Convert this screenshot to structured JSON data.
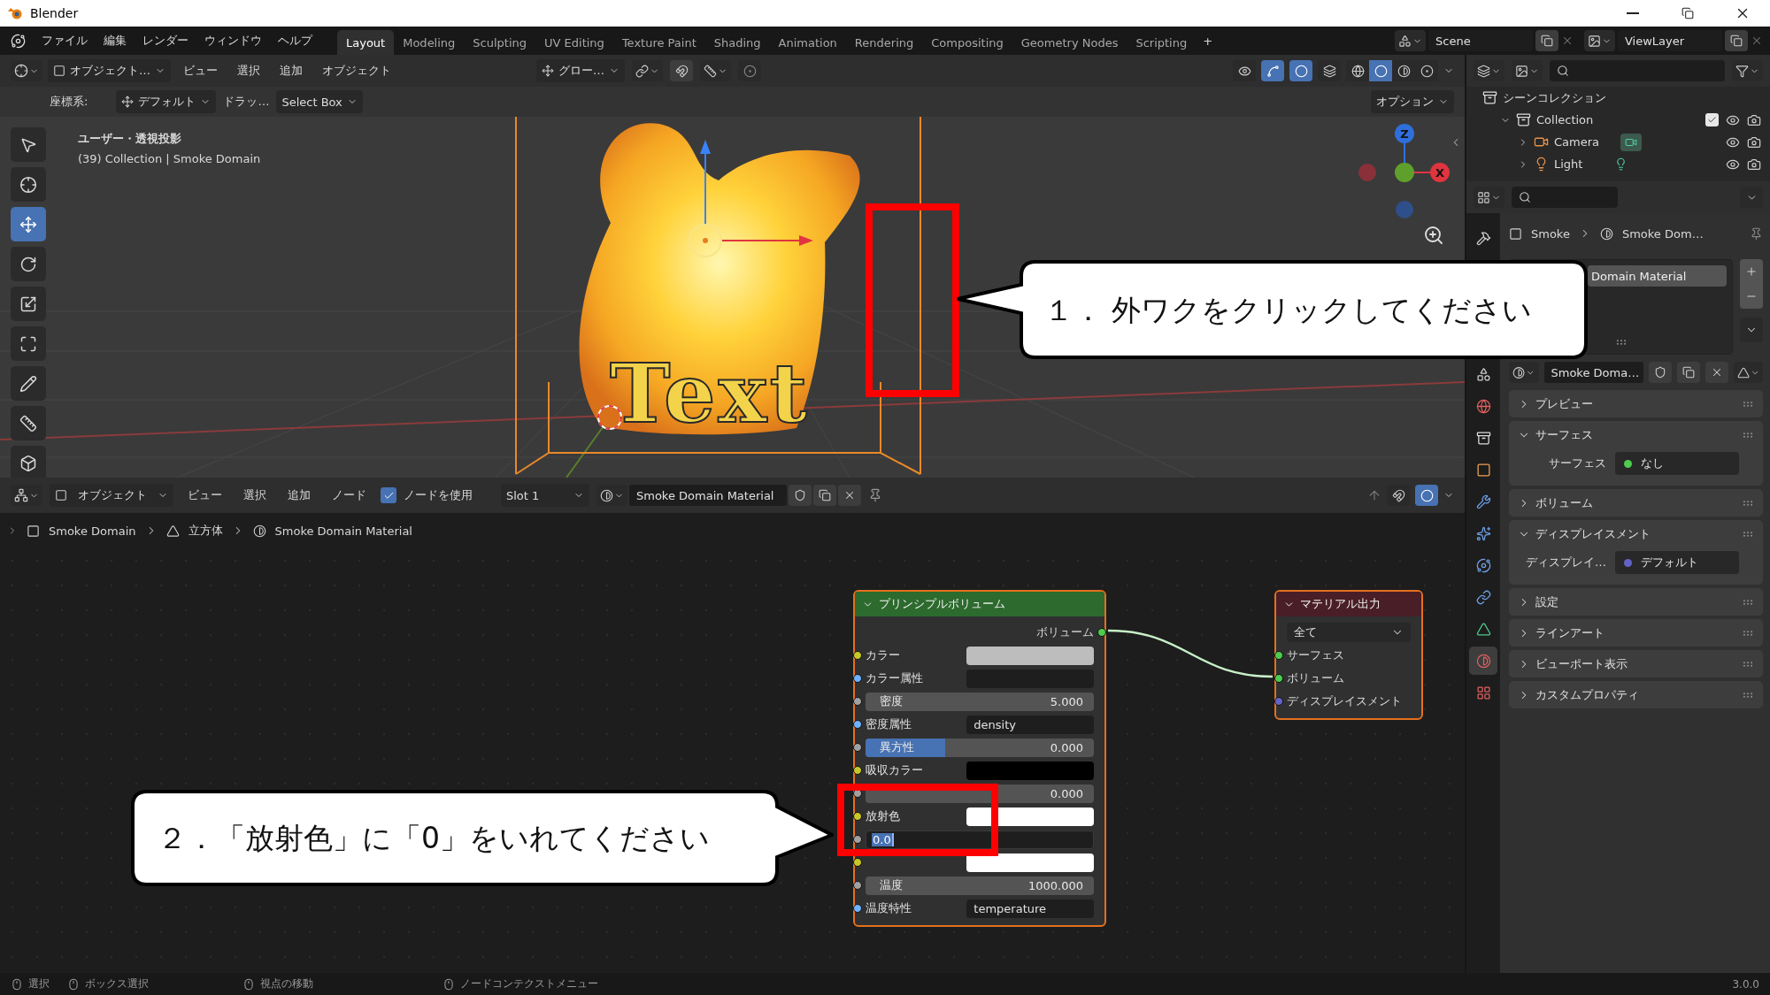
{
  "window": {
    "title": "Blender"
  },
  "menu": [
    "ファイル",
    "編集",
    "レンダー",
    "ウィンドウ",
    "ヘルプ"
  ],
  "workspaces": [
    {
      "label": "Layout",
      "selected": true
    },
    {
      "label": "Modeling",
      "selected": false
    },
    {
      "label": "Sculpting",
      "selected": false
    },
    {
      "label": "UV Editing",
      "selected": false
    },
    {
      "label": "Texture Paint",
      "selected": false
    },
    {
      "label": "Shading",
      "selected": false
    },
    {
      "label": "Animation",
      "selected": false
    },
    {
      "label": "Rendering",
      "selected": false
    },
    {
      "label": "Compositing",
      "selected": false
    },
    {
      "label": "Geometry Nodes",
      "selected": false
    },
    {
      "label": "Scripting",
      "selected": false
    }
  ],
  "add_workspace": "+",
  "scene": "Scene",
  "view_layer": "ViewLayer",
  "viewport": {
    "mode": "オブジェクト…",
    "menus": [
      "ビュー",
      "選択",
      "追加",
      "オブジェクト"
    ],
    "orientation": "グロー…",
    "toggles": [
      {
        "kind": "visibility",
        "on": false
      },
      {
        "kind": "gizmo",
        "on": true
      },
      {
        "kind": "overlay",
        "on": true
      },
      {
        "kind": "xray",
        "on": false
      }
    ],
    "shading": [
      {
        "kind": "wireframe",
        "selected": false
      },
      {
        "kind": "solid",
        "selected": true
      },
      {
        "kind": "material",
        "selected": false
      },
      {
        "kind": "rendered",
        "selected": false
      }
    ],
    "coord_label": "座標系:",
    "coord_value": "デフォルト",
    "drag_label": "ドラッ…",
    "drag_value": "Select Box",
    "options": "オプション",
    "view_name": "ユーザー・透視投影",
    "context": "(39) Collection | Smoke Domain",
    "scene_text": "Text",
    "gizmo_axes": [
      "Z",
      "X"
    ],
    "tools": [
      {
        "kind": "select",
        "selected": false
      },
      {
        "kind": "cursor",
        "selected": false
      },
      {
        "kind": "move",
        "selected": true
      },
      {
        "kind": "rotate",
        "selected": false
      },
      {
        "kind": "scale",
        "selected": false
      },
      {
        "kind": "transform",
        "selected": false
      },
      {
        "kind": "annotate",
        "selected": false
      },
      {
        "kind": "measure",
        "selected": false
      },
      {
        "kind": "add_cube",
        "selected": false
      }
    ]
  },
  "node_editor": {
    "mode": "オブジェクト",
    "menus": [
      "ビュー",
      "選択",
      "追加",
      "ノード"
    ],
    "use_nodes": {
      "label": "ノードを使用",
      "checked": true
    },
    "slot": "Slot 1",
    "material": "Smoke Domain Material",
    "toggles": [
      {
        "kind": "snap",
        "on": false
      },
      {
        "kind": "overlay",
        "on": true
      }
    ],
    "breadcrumb": [
      {
        "kind": "object",
        "label": "Smoke Domain"
      },
      {
        "kind": "mesh",
        "label": "立方体"
      },
      {
        "kind": "material",
        "label": "Smoke Domain Material"
      }
    ],
    "nodes": [
      {
        "kind": "shader",
        "title": "プリンシプルボリューム",
        "rows": [
          {
            "kind": "output",
            "label": "ボリューム",
            "color": "#4dcc4d"
          },
          {
            "kind": "swatch",
            "label": "カラー",
            "color": "#bdbdbd"
          },
          {
            "kind": "field",
            "label": "カラー属性"
          },
          {
            "kind": "number",
            "label": "密度",
            "value": "5.000"
          },
          {
            "kind": "field",
            "label": "密度属性",
            "value": "density"
          },
          {
            "kind": "slider",
            "label": "異方性",
            "value": "0.000",
            "level": 0.35
          },
          {
            "kind": "swatch",
            "label": "吸収カラー",
            "color": "#000000"
          },
          {
            "kind": "number",
            "value": "0.000"
          },
          {
            "kind": "swatch",
            "label": "放射色",
            "color": "#ffffff"
          },
          {
            "kind": "edit",
            "value": "0.0"
          },
          {
            "kind": "swatch",
            "color": "#ffffff"
          },
          {
            "kind": "number",
            "label": "温度",
            "value": "1000.000"
          },
          {
            "kind": "field",
            "label": "温度特性",
            "value": "temperature"
          }
        ]
      },
      {
        "kind": "output",
        "title": "マテリアル出力",
        "rows": [
          {
            "kind": "select",
            "value": "全て"
          },
          {
            "kind": "input",
            "label": "サーフェス",
            "color": "#4dcc4d"
          },
          {
            "kind": "input",
            "label": "ボリューム",
            "color": "#4dcc4d"
          },
          {
            "kind": "input",
            "label": "ディスプレイスメント",
            "color": "#6363c7"
          }
        ]
      }
    ]
  },
  "outliner": {
    "tree": [
      {
        "kind": "scene",
        "label": "シーンコレクション",
        "children": [
          {
            "kind": "collection",
            "label": "Collection",
            "expanded": true,
            "checked": true,
            "children": [
              {
                "kind": "camera",
                "label": "Camera",
                "expanded": false
              },
              {
                "kind": "light",
                "label": "Light",
                "expanded": false
              }
            ]
          }
        ]
      }
    ]
  },
  "properties": {
    "breadcrumb": [
      {
        "kind": "object",
        "label": "Smoke"
      },
      {
        "kind": "material",
        "label": "Smoke Dom…"
      }
    ],
    "slot_item": "Domain Material",
    "material": "Smoke Doma…",
    "tabs": [
      {
        "kind": "tool",
        "selected": false
      },
      {
        "kind": "scene",
        "selected": false
      },
      {
        "kind": "world",
        "selected": false
      },
      {
        "kind": "collection",
        "selected": false
      },
      {
        "kind": "object",
        "selected": false
      },
      {
        "kind": "modifier",
        "selected": false
      },
      {
        "kind": "particles",
        "selected": false
      },
      {
        "kind": "physics",
        "selected": false
      },
      {
        "kind": "constraint",
        "selected": false
      },
      {
        "kind": "data",
        "selected": false
      },
      {
        "kind": "material",
        "selected": true
      },
      {
        "kind": "texture",
        "selected": false
      }
    ],
    "panels": [
      {
        "title": "プレビュー",
        "expanded": false
      },
      {
        "title": "サーフェス",
        "expanded": true,
        "field": {
          "label": "サーフェス",
          "value": "なし",
          "color": "#4dcc4d"
        }
      },
      {
        "title": "ボリューム",
        "expanded": false
      },
      {
        "title": "ディスプレイスメント",
        "expanded": true,
        "field": {
          "label": "ディスプレイ…",
          "value": "デフォルト",
          "color": "#6363c7"
        }
      },
      {
        "title": "設定",
        "expanded": false
      },
      {
        "title": "ラインアート",
        "expanded": false
      },
      {
        "title": "ビューポート表示",
        "expanded": false
      },
      {
        "title": "カスタムプロパティ",
        "expanded": false
      }
    ]
  },
  "status_bar": {
    "hints": [
      "選択",
      "ボックス選択",
      "視点の移動",
      "ノードコンテクストメニュー"
    ],
    "version": "3.0.0"
  },
  "callouts": [
    {
      "text": "１． 外ワクをクリックしてください"
    },
    {
      "text": "２．「放射色」に「0」をいれてください"
    }
  ]
}
